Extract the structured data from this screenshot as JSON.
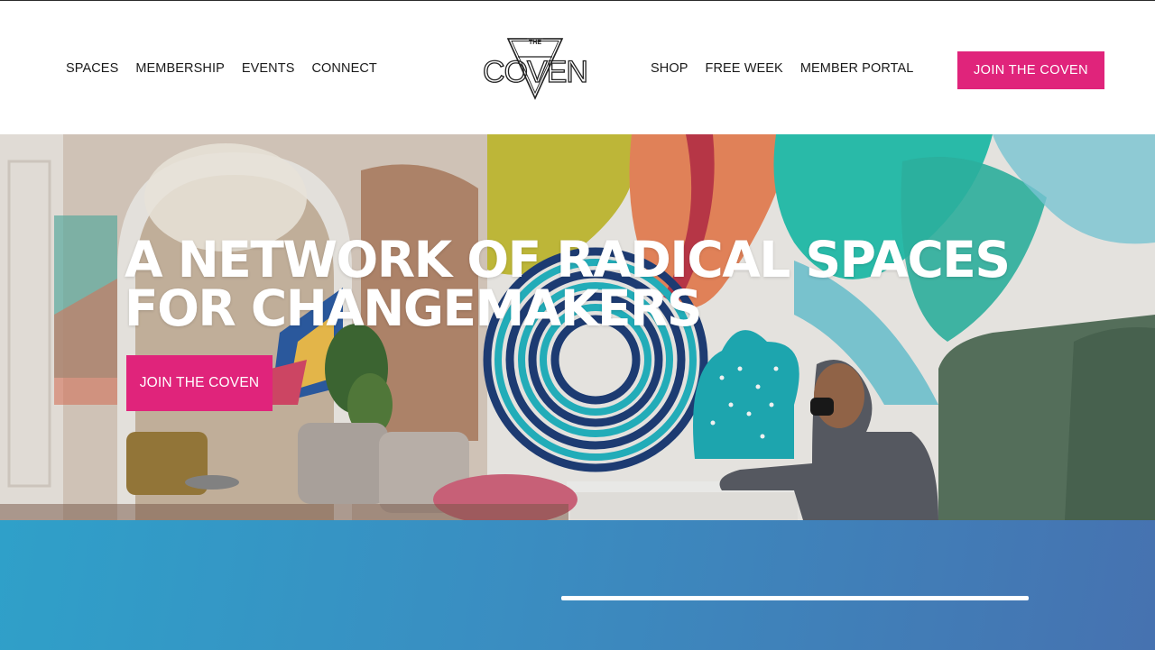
{
  "header": {
    "nav_left": [
      {
        "label": "SPACES"
      },
      {
        "label": "MEMBERSHIP"
      },
      {
        "label": "EVENTS"
      },
      {
        "label": "CONNECT"
      }
    ],
    "nav_right": [
      {
        "label": "SHOP"
      },
      {
        "label": "FREE WEEK"
      },
      {
        "label": "MEMBER PORTAL"
      }
    ],
    "logo": {
      "small_text": "THE",
      "wordmark": "COVEN"
    },
    "cta_label": "JOIN THE COVEN"
  },
  "hero": {
    "title_line1": "A NETWORK OF RADICAL SPACES",
    "title_line2": "FOR CHANGEMAKERS",
    "cta_label": "JOIN THE COVEN",
    "photo_subject": "coworking-lounge-photo"
  },
  "colors": {
    "accent": "#e0247b",
    "band_start": "#2fa0c9",
    "band_end": "#4672b0",
    "text_dark": "#1a1a1a"
  }
}
